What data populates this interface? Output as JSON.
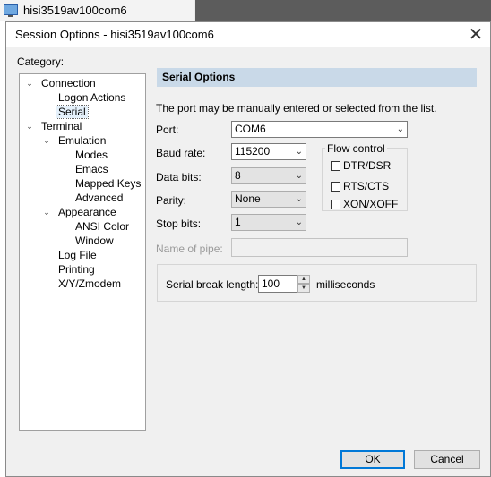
{
  "background": {
    "tab_label": "hisi3519av100com6"
  },
  "dialog": {
    "title": "Session Options - hisi3519av100com6",
    "close_glyph": "✕"
  },
  "category": {
    "label": "Category:",
    "items": [
      {
        "label": "Connection",
        "expander": "⌄"
      },
      {
        "label": "Logon Actions"
      },
      {
        "label": "Serial",
        "selected": true
      },
      {
        "label": "Terminal",
        "expander": "⌄"
      },
      {
        "label": "Emulation",
        "expander": "⌄"
      },
      {
        "label": "Modes"
      },
      {
        "label": "Emacs"
      },
      {
        "label": "Mapped Keys"
      },
      {
        "label": "Advanced"
      },
      {
        "label": "Appearance",
        "expander": "⌄"
      },
      {
        "label": "ANSI Color"
      },
      {
        "label": "Window"
      },
      {
        "label": "Log File"
      },
      {
        "label": "Printing"
      },
      {
        "label": "X/Y/Zmodem"
      }
    ]
  },
  "serial": {
    "header": "Serial Options",
    "description": "The port may be manually entered or selected from the list.",
    "port": {
      "label": "Port:",
      "value": "COM6"
    },
    "baud_rate": {
      "label": "Baud rate:",
      "value": "115200"
    },
    "data_bits": {
      "label": "Data bits:",
      "value": "8"
    },
    "parity": {
      "label": "Parity:",
      "value": "None"
    },
    "stop_bits": {
      "label": "Stop bits:",
      "value": "1"
    },
    "pipe": {
      "label": "Name of pipe:",
      "value": ""
    },
    "flow_control": {
      "title": "Flow control",
      "options": [
        {
          "label": "DTR/DSR",
          "checked": false
        },
        {
          "label": "RTS/CTS",
          "checked": false
        },
        {
          "label": "XON/XOFF",
          "checked": false
        }
      ]
    },
    "break_length": {
      "label": "Serial break length:",
      "value": "100",
      "unit": "milliseconds"
    }
  },
  "buttons": {
    "ok": "OK",
    "cancel": "Cancel"
  },
  "glyphs": {
    "dropdown_arrow": "⌄",
    "spin_up": "▲",
    "spin_down": "▼"
  }
}
